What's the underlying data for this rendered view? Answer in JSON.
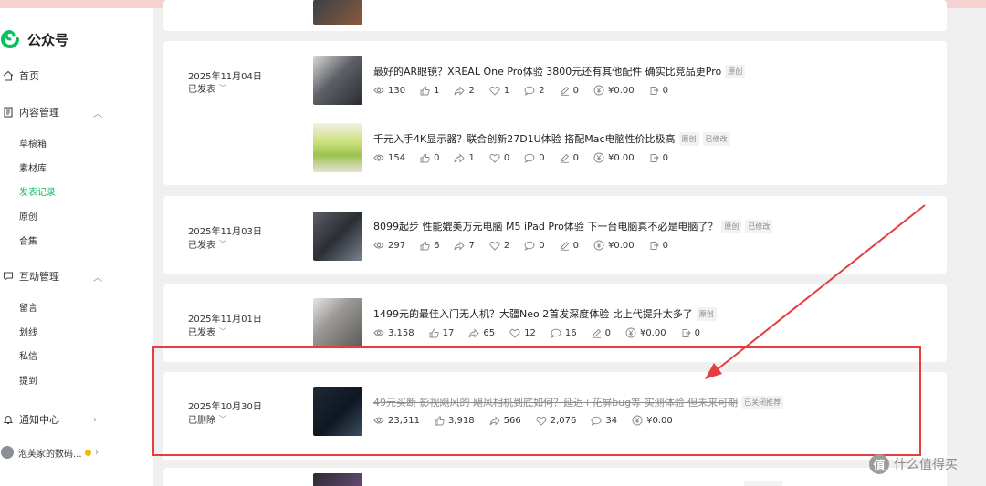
{
  "app": {
    "name": "公众号"
  },
  "sidebar": {
    "home": "首页",
    "content": "内容管理",
    "content_items": [
      "草稿箱",
      "素材库",
      "发表记录",
      "原创",
      "合集"
    ],
    "interact": "互动管理",
    "interact_items": [
      "留言",
      "划线",
      "私信",
      "提到"
    ],
    "notify": "通知中心",
    "account": "泡芙家的数码..."
  },
  "posts": [
    {
      "date": "2025年11月04日",
      "status": "已发表",
      "articles": [
        {
          "title": "最好的AR眼镜？XREAL One Pro体验 3800元还有其他配件 确实比竞品更Pro",
          "tags": [
            "原创"
          ],
          "stats": {
            "views": "130",
            "likes": "1",
            "shares": "2",
            "favs": "1",
            "comments": "2",
            "lines": "0",
            "income": "¥0.00",
            "export": "0"
          }
        },
        {
          "title": "千元入手4K显示器？联合创新27D1U体验 搭配Mac电脑性价比极高",
          "tags": [
            "原创",
            "已修改"
          ],
          "stats": {
            "views": "154",
            "likes": "0",
            "shares": "1",
            "favs": "0",
            "comments": "0",
            "lines": "0",
            "income": "¥0.00",
            "export": "0"
          }
        }
      ]
    },
    {
      "date": "2025年11月03日",
      "status": "已发表",
      "articles": [
        {
          "title": "8099起步 性能媲美万元电脑 M5 iPad Pro体验 下一台电脑真不必是电脑了？",
          "tags": [
            "原创",
            "已修改"
          ],
          "stats": {
            "views": "297",
            "likes": "6",
            "shares": "7",
            "favs": "2",
            "comments": "0",
            "lines": "0",
            "income": "¥0.00",
            "export": "0"
          }
        }
      ]
    },
    {
      "date": "2025年11月01日",
      "status": "已发表",
      "articles": [
        {
          "title": "1499元的最佳入门无人机？大疆Neo 2首发深度体验 比上代提升太多了",
          "tags": [
            "原创"
          ],
          "stats": {
            "views": "3,158",
            "likes": "17",
            "shares": "65",
            "favs": "12",
            "comments": "16",
            "lines": "0",
            "income": "¥0.00",
            "export": "0"
          }
        }
      ]
    },
    {
      "date": "2025年10月30日",
      "status": "已删除",
      "articles": [
        {
          "title": "49元买断 影视飓风的 飓风相机到底如何？延迟+花屏bug等 实测体验 但未来可期",
          "tags": [
            "已关闭推荐"
          ],
          "stats": {
            "views": "23,511",
            "likes": "3,918",
            "shares": "566",
            "favs": "2,076",
            "comments": "34",
            "income": "¥0.00"
          }
        }
      ]
    }
  ],
  "watermark": {
    "logo": "值",
    "text": "什么值得买"
  },
  "colors": {
    "accent": "#07c160",
    "highlight": "#e53e3e",
    "sidebar_bg": "#ffffff",
    "page_bg": "#f0f0f0"
  },
  "icons": [
    "eye-icon",
    "thumb-up-icon",
    "share-icon",
    "heart-icon",
    "comment-icon",
    "pen-icon",
    "yuan-icon",
    "export-icon"
  ]
}
